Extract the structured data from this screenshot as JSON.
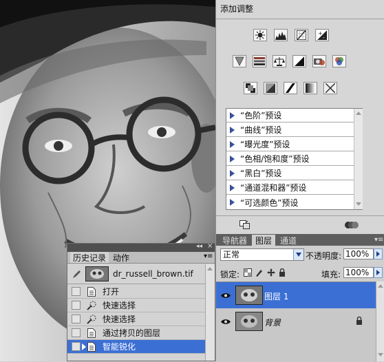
{
  "adjustments": {
    "title": "添加调整",
    "presets": [
      "“色阶”预设",
      "“曲线”预设",
      "“曝光度”预设",
      "“色相/饱和度”预设",
      "“黑白”预设",
      "“通道混和器”预设",
      "“可选颜色”预设"
    ]
  },
  "layers": {
    "tabs": [
      "导航器",
      "图层",
      "通道"
    ],
    "active_tab": "图层",
    "blend_mode": "正常",
    "opacity_label": "不透明度:",
    "opacity_value": "100%",
    "lock_label": "锁定:",
    "fill_label": "填充:",
    "fill_value": "100%",
    "items": [
      {
        "name": "图层 1",
        "selected": true
      },
      {
        "name": "背景",
        "selected": false,
        "locked": true
      }
    ]
  },
  "history": {
    "tabs": [
      "历史记录",
      "动作"
    ],
    "active_tab": "历史记录",
    "snapshot_name": "dr_russell_brown.tif",
    "steps": [
      "打开",
      "快速选择",
      "快速选择",
      "通过拷贝的图层",
      "智能锐化"
    ],
    "selected_step": "智能锐化"
  },
  "colors": {
    "selection": "#3b6fd4",
    "panel_bg": "#d6d6d6",
    "tab_bar": "#5e5e5e"
  }
}
